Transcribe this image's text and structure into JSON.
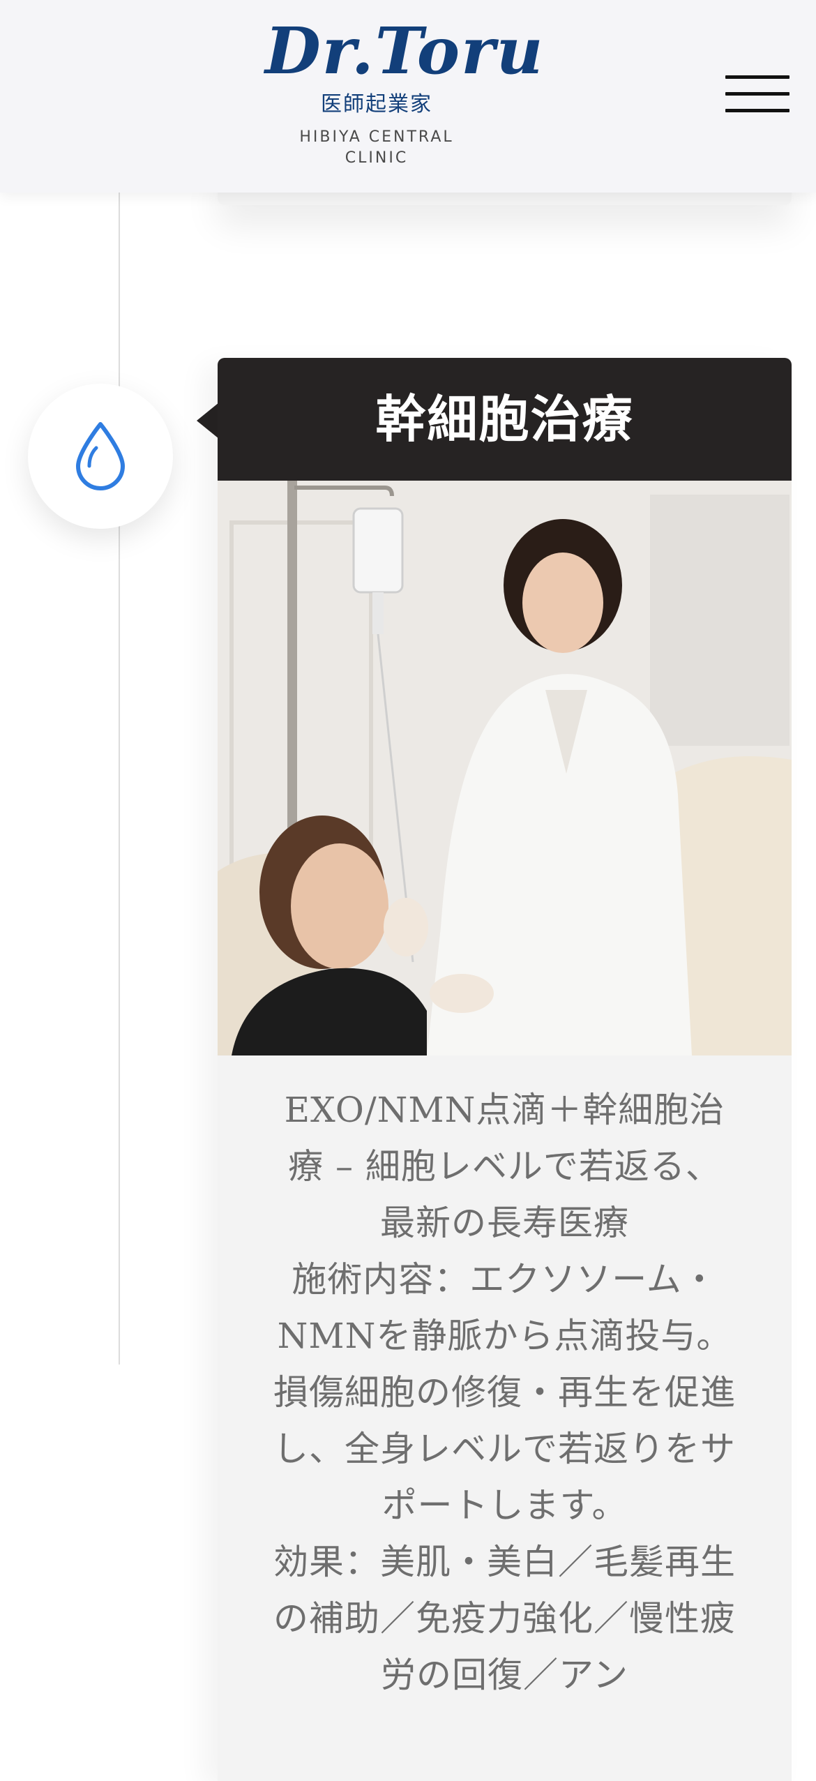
{
  "header": {
    "logo_script": "Dr.Toru",
    "logo_jp": "医師起業家",
    "logo_en": "HIBIYA CENTRAL CLINIC"
  },
  "timeline": {
    "icon": "water-drop-icon",
    "accent_color": "#2f7de1"
  },
  "card": {
    "title": "幹細胞治療",
    "title_bg": "#262323",
    "image": "doctor-treating-patient-with-iv-drip-photo",
    "paragraphs": [
      "EXO/NMN点滴＋幹細胞治療 – 細胞レベルで若返る、最新の長寿医療",
      "施術内容：エクソソーム・NMNを静脈から点滴投与。損傷細胞の修復・再生を促進し、全身レベルで若返りをサポートします。",
      "効果：美肌・美白／毛髪再生の補助／免疫力強化／慢性疲労の回復／アン"
    ]
  }
}
